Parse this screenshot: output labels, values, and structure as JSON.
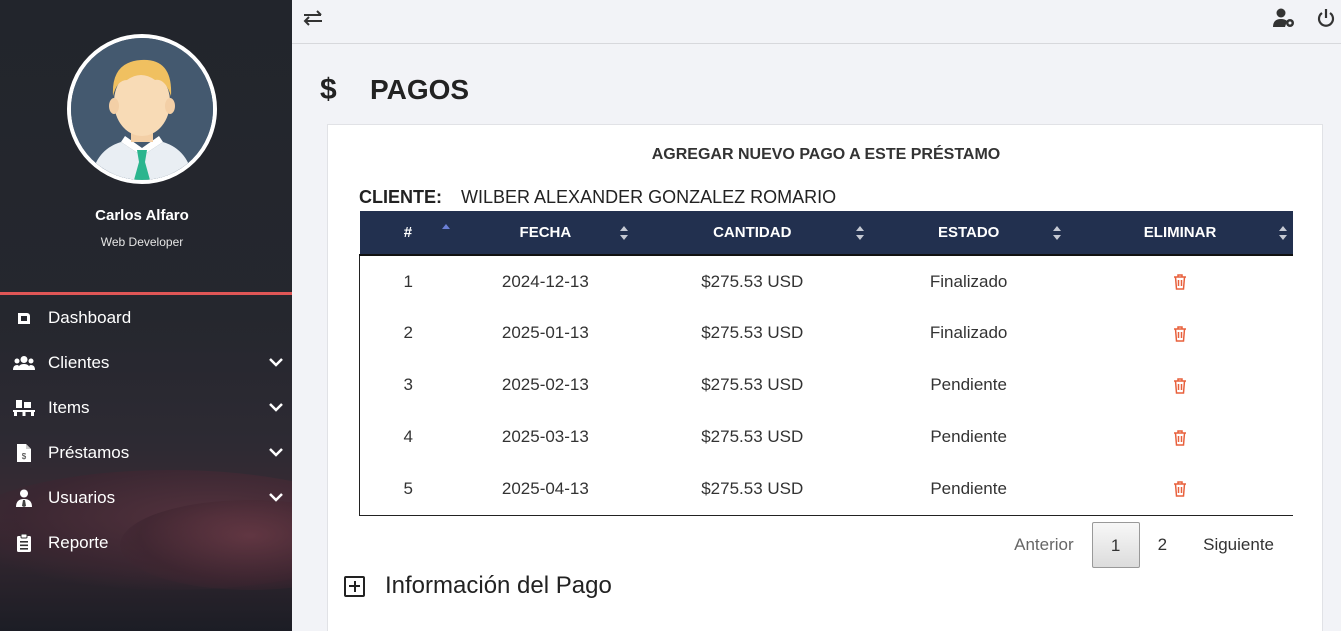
{
  "user": {
    "name": "Carlos Alfaro",
    "role": "Web Developer"
  },
  "nav": [
    {
      "label": "Dashboard",
      "icon": "dashboard-icon",
      "expandable": false
    },
    {
      "label": "Clientes",
      "icon": "users-icon",
      "expandable": true
    },
    {
      "label": "Items",
      "icon": "pallet-icon",
      "expandable": true
    },
    {
      "label": "Préstamos",
      "icon": "invoice-icon",
      "expandable": true
    },
    {
      "label": "Usuarios",
      "icon": "user-tie-icon",
      "expandable": true
    },
    {
      "label": "Reporte",
      "icon": "clipboard-icon",
      "expandable": false
    }
  ],
  "page": {
    "title": "PAGOS",
    "icon": "dollar-icon"
  },
  "card": {
    "title": "AGREGAR NUEVO PAGO A ESTE PRÉSTAMO",
    "client_label": "CLIENTE:",
    "client_name": "WILBER ALEXANDER GONZALEZ ROMARIO"
  },
  "table": {
    "headers": [
      "#",
      "FECHA",
      "CANTIDAD",
      "ESTADO",
      "ELIMINAR"
    ],
    "rows": [
      {
        "n": "1",
        "fecha": "2024-12-13",
        "cantidad": "$275.53 USD",
        "estado": "Finalizado"
      },
      {
        "n": "2",
        "fecha": "2025-01-13",
        "cantidad": "$275.53 USD",
        "estado": "Finalizado"
      },
      {
        "n": "3",
        "fecha": "2025-02-13",
        "cantidad": "$275.53 USD",
        "estado": "Pendiente"
      },
      {
        "n": "4",
        "fecha": "2025-03-13",
        "cantidad": "$275.53 USD",
        "estado": "Pendiente"
      },
      {
        "n": "5",
        "fecha": "2025-04-13",
        "cantidad": "$275.53 USD",
        "estado": "Pendiente"
      }
    ]
  },
  "pagination": {
    "prev": "Anterior",
    "pages": [
      "1",
      "2"
    ],
    "current": "1",
    "next": "Siguiente"
  },
  "info_section": {
    "title": "Información del Pago"
  },
  "colors": {
    "accent_red": "#e05656",
    "table_header": "#22304f",
    "trash": "#e8603c"
  }
}
